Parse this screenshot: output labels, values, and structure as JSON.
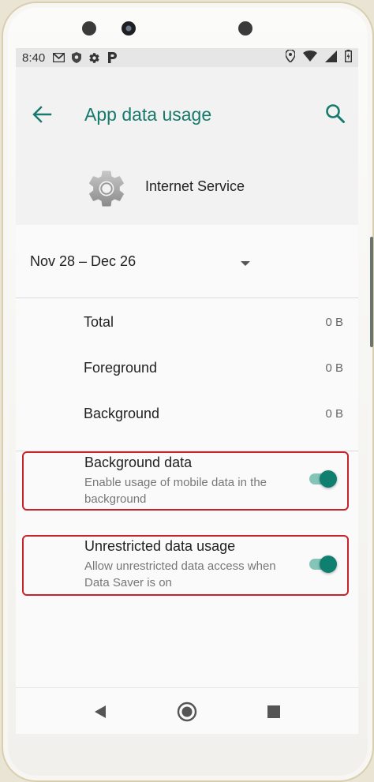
{
  "status_bar": {
    "time": "8:40",
    "icons_left": [
      "gmail-icon",
      "shield-icon",
      "gear-icon",
      "parking-icon"
    ],
    "icons_right": [
      "location-icon",
      "wifi-icon",
      "signal-icon",
      "battery-icon"
    ]
  },
  "app_bar": {
    "title": "App data usage",
    "back_icon": "arrow-left-icon",
    "search_icon": "search-icon"
  },
  "app": {
    "name": "Internet Service",
    "icon": "gear-icon"
  },
  "period": {
    "label": "Nov 28 – Dec 26"
  },
  "usage": [
    {
      "label": "Total",
      "value": "0 B"
    },
    {
      "label": "Foreground",
      "value": "0 B"
    },
    {
      "label": "Background",
      "value": "0 B"
    }
  ],
  "settings": [
    {
      "title": "Background data",
      "subtitle": "Enable usage of mobile data in the background",
      "enabled": true
    },
    {
      "title": "Unrestricted data usage",
      "subtitle": "Allow unrestricted data access when Data Saver is on",
      "enabled": true
    }
  ],
  "colors": {
    "accent": "#177a6d",
    "toggle_thumb": "#0f7f70",
    "toggle_track": "#85c5b9",
    "highlight_border": "#c8222c"
  }
}
